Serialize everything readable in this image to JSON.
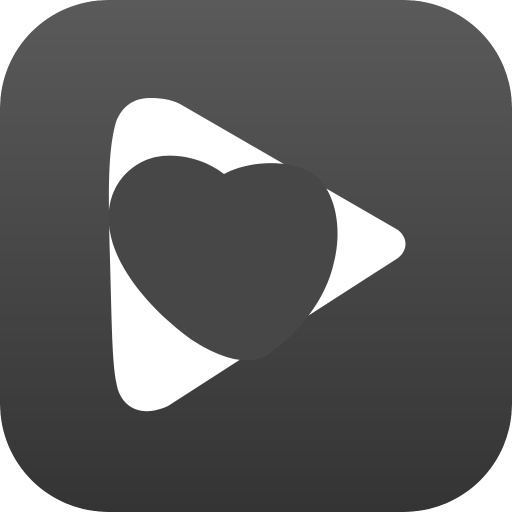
{
  "icon": {
    "name": "play-heart-app-icon",
    "background_top": "#5a5a5a",
    "background_bottom": "#343434",
    "glyph_color": "#ffffff"
  }
}
